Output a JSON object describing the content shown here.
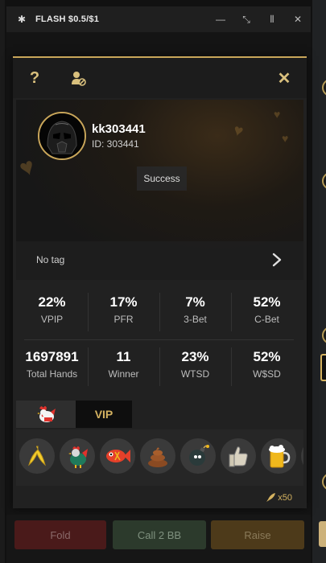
{
  "window": {
    "title": "FLASH $0.5/$1"
  },
  "profile": {
    "username": "kk303441",
    "user_id": "ID: 303441",
    "toast": "Success",
    "tag": "No tag"
  },
  "stats": [
    {
      "value": "22%",
      "label": "VPIP"
    },
    {
      "value": "17%",
      "label": "PFR"
    },
    {
      "value": "7%",
      "label": "3-Bet"
    },
    {
      "value": "52%",
      "label": "C-Bet"
    },
    {
      "value": "1697891",
      "label": "Total Hands"
    },
    {
      "value": "11",
      "label": "Winner"
    },
    {
      "value": "23%",
      "label": "WTSD"
    },
    {
      "value": "52%",
      "label": "W$SD"
    }
  ],
  "tabs": {
    "vip": "VIP"
  },
  "emojis": [
    "banana",
    "rooster",
    "fish",
    "poop",
    "bomb",
    "thumbs-up",
    "beer"
  ],
  "multiplier": "x50",
  "actions": {
    "fold": "Fold",
    "call": "Call 2 BB",
    "raise": "Raise"
  },
  "colors": {
    "accent_gold": "#c9a65a",
    "fold": "#4a1a1a",
    "call": "#2c3a2c",
    "raise": "#4d3a1a"
  }
}
